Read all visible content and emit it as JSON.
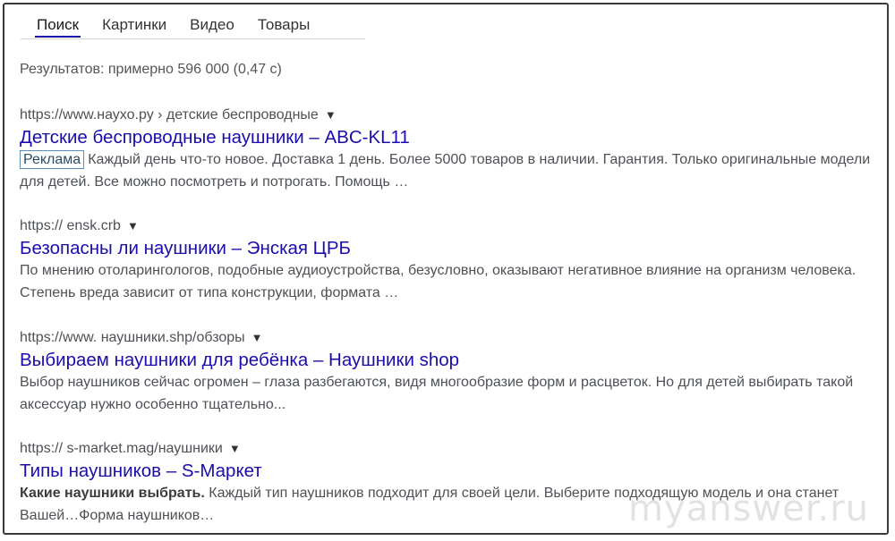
{
  "tabs": [
    {
      "label": "Поиск",
      "active": true
    },
    {
      "label": "Картинки",
      "active": false
    },
    {
      "label": "Видео",
      "active": false
    },
    {
      "label": "Товары",
      "active": false
    }
  ],
  "result_stats": "Результатов: примерно 596 000 (0,47 с)",
  "dropdown_arrow": "▼",
  "results": [
    {
      "url": "https://www.наухо.ру › детские беспроводные",
      "title": "Детские беспроводные наушники – ABC-KL11",
      "ad_badge": "Реклама",
      "snippet_bold": "",
      "snippet": "Каждый день что-то новое. Доставка 1 день. Более 5000 товаров в наличии. Гарантия. Только оригинальные модели для детей. Все можно посмотреть и потрогать. Помощь …"
    },
    {
      "url": "https:// ensk.crb",
      "title": "Безопасны ли наушники – Энская ЦРБ",
      "snippet": "По мнению отоларингологов, подобные аудиоустройства, безусловно, оказывают негативное влияние на организм человека. Степень вреда зависит от типа конструкции, формата …"
    },
    {
      "url": "https://www. наушники.shp/обзоры",
      "title": "Выбираем наушники для ребёнка – Наушники shop",
      "snippet": "Выбор наушников сейчас огромен – глаза разбегаются, видя многообразие форм и расцветок. Но для детей выбирать такой аксессуар нужно особенно тщательно..."
    },
    {
      "url": "https:// s-market.mag/наушники",
      "title": "Типы наушников – S-Маркет",
      "snippet_bold": "Какие наушники выбрать.",
      "snippet": " Каждый тип наушников подходит для своей цели. Выберите подходящую модель и она станет Вашей…Форма наушников…"
    }
  ],
  "watermark": "myanswer.ru",
  "colors": {
    "link": "#1a0dab",
    "url_text": "#4d5156",
    "snippet_text": "#4d5156",
    "ad_badge_border": "#5b8db8"
  }
}
